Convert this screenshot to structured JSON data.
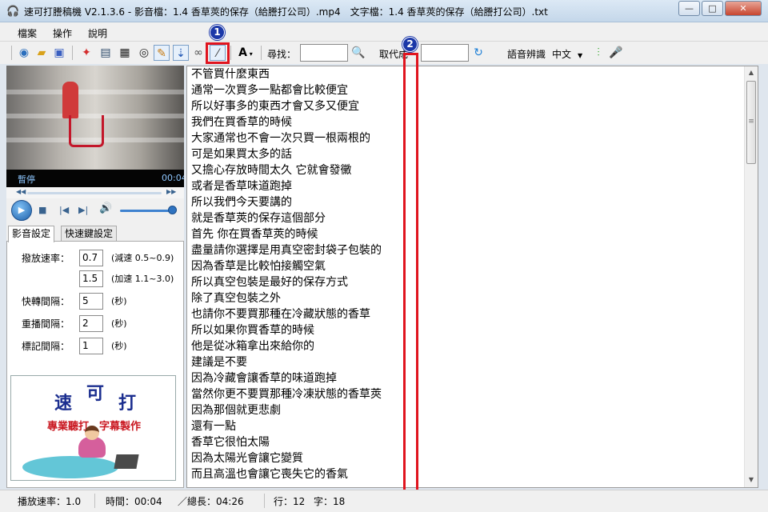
{
  "window": {
    "title": "速可打謄稿機 V2.1.3.6 - 影音檔：1.4 香草莢的保存（給謄打公司）.mp4　文字檔：1.4 香草莢的保存（給謄打公司）.txt",
    "app_icon": "headphones-icon",
    "minimize": "—",
    "maximize": "□",
    "close": "✕"
  },
  "menu": [
    "檔案",
    "操作",
    "說明"
  ],
  "toolbar": {
    "font_button": "A",
    "find_label": "尋找：",
    "find_value": "",
    "replace_label": "取代成",
    "replace_value": "",
    "speech_label": "語音辨識",
    "language": "中文",
    "icons": [
      "open-icon",
      "folder-icon",
      "save-icon",
      "pin-icon",
      "window-icon",
      "film-icon",
      "eye-icon",
      "pencil-icon",
      "timestamp-icon",
      "link-icon",
      "ruler-icon",
      "font-icon",
      "search-icon",
      "replace-icon",
      "waveform-icon",
      "microphone-icon"
    ]
  },
  "player": {
    "status": "暫停",
    "time": "00:04",
    "play": "▶",
    "stop": "■",
    "prev": "|◀",
    "next": "▶|",
    "volume_fraction": 0.9
  },
  "tabs": [
    "影音設定",
    "快速鍵設定"
  ],
  "settings": {
    "rows": [
      {
        "label": "撥放速率：",
        "value": "0.7",
        "note": "(減速 0.5~0.9)"
      },
      {
        "label": "",
        "value": "1.5",
        "note": "(加速 1.1~3.0)"
      },
      {
        "label": "快轉間隔：",
        "value": "5",
        "note": "(秒)"
      },
      {
        "label": "重播間隔：",
        "value": "2",
        "note": "(秒)"
      },
      {
        "label": "標記間隔：",
        "value": "1",
        "note": "(秒)"
      }
    ]
  },
  "ad": {
    "logo_1": "速",
    "logo_2": "可",
    "logo_3": "打",
    "subtitle": "專業聽打、字幕製作"
  },
  "lines": [
    "不管買什麼東西",
    "通常一次買多一點都會比較便宜",
    "所以好事多的東西才會又多又便宜",
    "我們在買香草的時候",
    "大家通常也不會一次只買一根兩根的",
    "可是如果買太多的話",
    "又擔心存放時間太久 它就會發黴",
    "或者是香草味道跑掉",
    "所以我們今天要講的",
    "就是香草莢的保存這個部分",
    "首先 你在買香草莢的時候",
    "盡量請你選擇是用真空密封袋子包裝的",
    "因為香草是比較怕接觸空氣",
    "所以真空包裝是最好的保存方式",
    "除了真空包裝之外",
    "也請你不要買那種在冷藏狀態的香草",
    "所以如果你買香草的時候",
    "他是從冰箱拿出來給你的",
    "建議是不要",
    "因為冷藏會讓香草的味道跑掉",
    "當然你更不要買那種冷凍狀態的香草莢",
    "因為那個就更悲劇",
    "還有一點",
    "香草它很怕太陽",
    "因為太陽光會讓它變質",
    "而且高溫也會讓它喪失它的香氣"
  ],
  "annotations": {
    "badge_1": "1",
    "badge_2": "2"
  },
  "status": {
    "speed": "播放速率：1.0",
    "time": "時間：00:04",
    "length": "／總長：04:26",
    "row": "行：12",
    "col": "字：18"
  },
  "colors": {
    "highlight": "#e0141e",
    "badge": "#1b38a8",
    "accent_green": "#3aa832"
  }
}
